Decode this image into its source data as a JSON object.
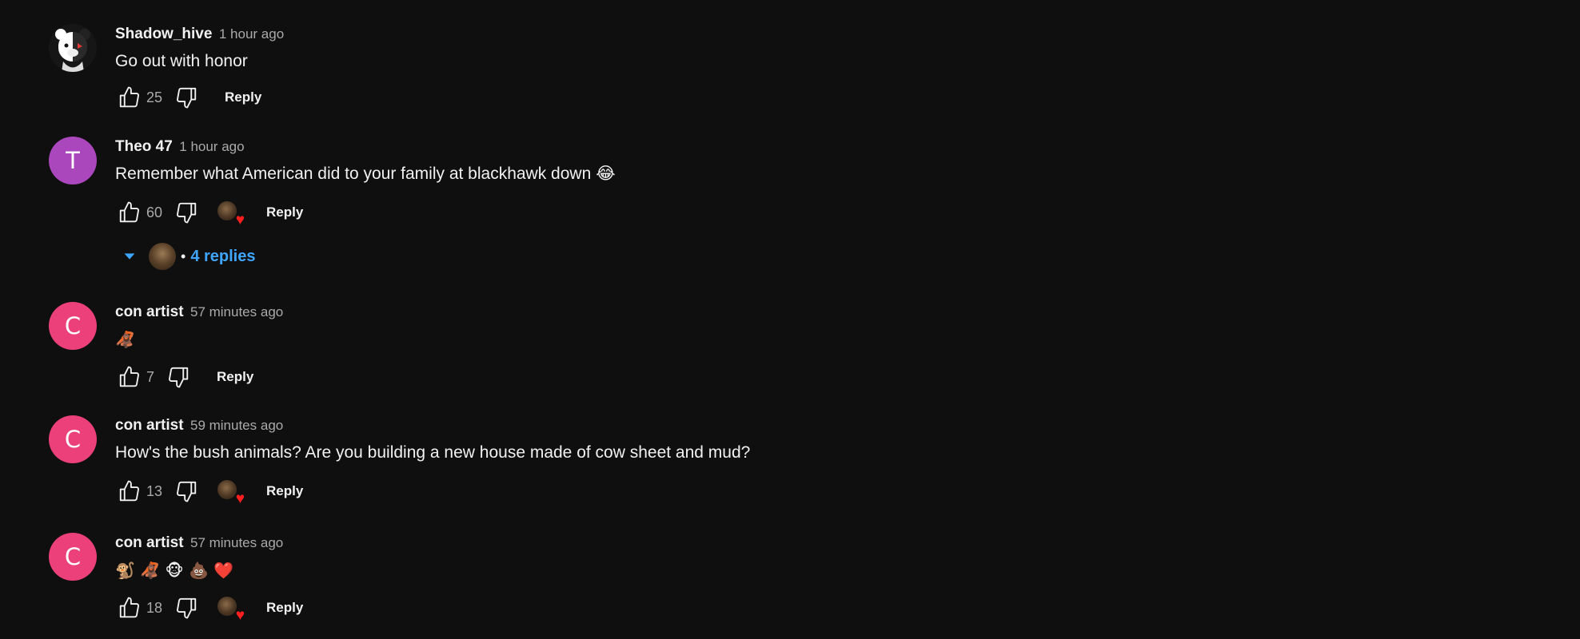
{
  "colors": {
    "background": "#0f0f0f",
    "link_blue": "#3ea6ff",
    "heart_red": "#ff1f1f",
    "avatar_purple": "#ab47bc",
    "avatar_pink": "#ec407a"
  },
  "comments": [
    {
      "author": "Shadow_hive",
      "time": "1 hour ago",
      "text": "Go out with honor",
      "likes": "25",
      "avatar_letter": "",
      "avatar_icon": "monokuma-bear-avatar",
      "hearted": false,
      "reply_label": "Reply"
    },
    {
      "author": "Theo 47",
      "time": "1 hour ago",
      "text": "Remember what American did to your family at blackhawk down 😂",
      "likes": "60",
      "avatar_letter": "T",
      "hearted": true,
      "reply_label": "Reply",
      "replies_label": "4 replies"
    },
    {
      "author": "con artist",
      "time": "57 minutes ago",
      "text": "🦧",
      "likes": "7",
      "avatar_letter": "C",
      "hearted": false,
      "reply_label": "Reply"
    },
    {
      "author": "con artist",
      "time": "59 minutes ago",
      "text": "How's the bush animals? Are you building a new house made of cow sheet and mud?",
      "likes": "13",
      "avatar_letter": "C",
      "hearted": true,
      "reply_label": "Reply"
    },
    {
      "author": "con artist",
      "time": "57 minutes ago",
      "text": "🐒 🦧 🐵 💩 ❤️",
      "likes": "18",
      "avatar_letter": "C",
      "hearted": true,
      "reply_label": "Reply"
    }
  ]
}
